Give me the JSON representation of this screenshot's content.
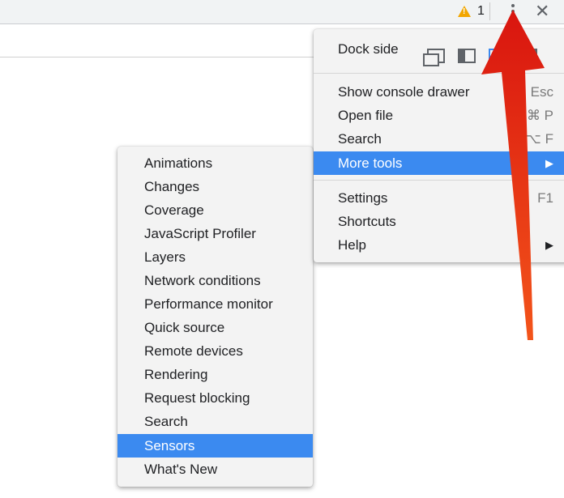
{
  "toolbar": {
    "warning_count": "1",
    "more_icon": "vertical-ellipsis-icon",
    "close_icon": "close-icon",
    "close_glyph": "✕"
  },
  "main_menu": {
    "dock_side_label": "Dock side",
    "dock_options": [
      "undock-into-separate-window-icon",
      "dock-to-left-icon",
      "dock-to-bottom-icon",
      "dock-to-right-icon"
    ],
    "items": [
      {
        "label": "Show console drawer",
        "shortcut": "Esc"
      },
      {
        "label": "Open file",
        "shortcut": "⌘ P"
      },
      {
        "label": "Search",
        "shortcut": "⌥ F"
      },
      {
        "label": "More tools",
        "submenu": true,
        "selected": true
      },
      {
        "label": "Settings",
        "shortcut": "F1"
      },
      {
        "label": "Shortcuts"
      },
      {
        "label": "Help",
        "submenu": true
      }
    ]
  },
  "more_tools_menu": {
    "items": [
      {
        "label": "Animations"
      },
      {
        "label": "Changes"
      },
      {
        "label": "Coverage"
      },
      {
        "label": "JavaScript Profiler"
      },
      {
        "label": "Layers"
      },
      {
        "label": "Network conditions"
      },
      {
        "label": "Performance monitor"
      },
      {
        "label": "Quick source"
      },
      {
        "label": "Remote devices"
      },
      {
        "label": "Rendering"
      },
      {
        "label": "Request blocking"
      },
      {
        "label": "Search"
      },
      {
        "label": "Sensors",
        "selected": true
      },
      {
        "label": "What's New"
      }
    ]
  },
  "colors": {
    "selection": "#3b8af0",
    "menu_bg": "#f3f3f3",
    "annotation_arrow": "#e8231a",
    "warning": "#f2a600"
  },
  "submenu_arrow_glyph": "▶"
}
